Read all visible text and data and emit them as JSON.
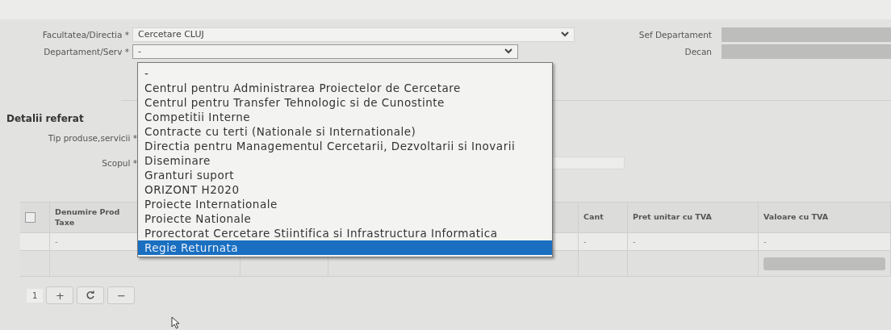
{
  "header_fields": {
    "left": [
      {
        "label": "Facultatea/Directia *",
        "value": "Cercetare CLUJ",
        "wide": true,
        "open": false
      },
      {
        "label": "Departament/Serv *",
        "value": "-",
        "wide": false,
        "open": true
      }
    ],
    "right": [
      {
        "label": "Sef Departament",
        "disabled": true
      },
      {
        "label": "Decan",
        "disabled": true
      }
    ]
  },
  "section": {
    "title": "Detalii referat",
    "fields": [
      {
        "label": "Tip produse,servicii *"
      },
      {
        "label": "Scopul *",
        "kind": "text"
      }
    ]
  },
  "dropdown": {
    "options": [
      {
        "label": "-",
        "selected": false
      },
      {
        "label": "Centrul pentru Administrarea Proiectelor de Cercetare",
        "selected": false
      },
      {
        "label": "Centrul pentru Transfer Tehnologic si de Cunostinte",
        "selected": false
      },
      {
        "label": "Competitii Interne",
        "selected": false
      },
      {
        "label": "Contracte cu terti (Nationale si Internationale)",
        "selected": false
      },
      {
        "label": "Directia pentru Managementul Cercetarii, Dezvoltarii si Inovarii",
        "selected": false
      },
      {
        "label": "Diseminare",
        "selected": false
      },
      {
        "label": "Granturi suport",
        "selected": false
      },
      {
        "label": "ORIZONT H2020",
        "selected": false
      },
      {
        "label": "Proiecte Internationale",
        "selected": false
      },
      {
        "label": "Proiecte Nationale",
        "selected": false
      },
      {
        "label": "Prorectorat Cercetare Stiintifica si Infrastructura Informatica",
        "selected": false
      },
      {
        "label": "Regie Returnata",
        "selected": true
      }
    ]
  },
  "table": {
    "columns": [
      {
        "kind": "checkbox",
        "checked": false
      },
      {
        "kind": "text",
        "lines": [
          "Denumire Prod",
          "Taxe"
        ]
      },
      {
        "kind": "blank"
      },
      {
        "kind": "blank"
      },
      {
        "kind": "text",
        "lines": [
          "Cant"
        ]
      },
      {
        "kind": "text",
        "lines": [
          "Pret unitar cu TVA"
        ]
      },
      {
        "kind": "text",
        "lines": [
          "Valoare cu TVA"
        ]
      }
    ],
    "rows": [
      {
        "kind": "item",
        "cells": [
          null,
          "-",
          null,
          null,
          "-",
          "-",
          "-"
        ]
      },
      {
        "kind": "total",
        "cells": [
          null,
          null,
          null,
          null,
          null,
          null,
          {
            "kind": "readonly",
            "disabled": true
          }
        ]
      }
    ]
  },
  "pager": {
    "page": "1",
    "buttons": [
      {
        "kind": "add",
        "label": "+"
      },
      {
        "kind": "refresh"
      },
      {
        "kind": "remove",
        "label": "−"
      }
    ]
  }
}
